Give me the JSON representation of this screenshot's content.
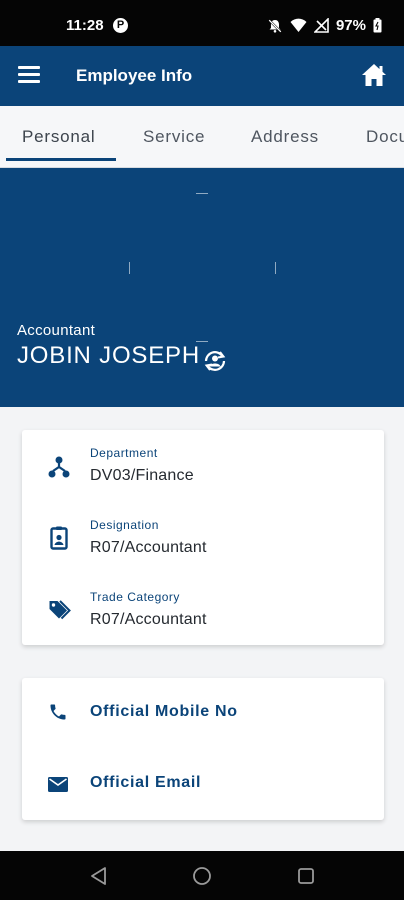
{
  "status_bar": {
    "time": "11:28",
    "notification_icon_letter": "P",
    "battery_percent": "97%",
    "icons": [
      "p-notification-icon",
      "silent-bell-icon",
      "wifi-icon",
      "signal-off-icon",
      "battery-icon"
    ]
  },
  "app_bar": {
    "title": "Employee Info",
    "menu_icon": "hamburger-menu-icon",
    "home_icon": "home-icon"
  },
  "tabs": [
    {
      "label": "Personal",
      "active": true
    },
    {
      "label": "Service",
      "active": false
    },
    {
      "label": "Address",
      "active": false
    },
    {
      "label": "Docu",
      "active": false
    }
  ],
  "profile": {
    "designation": "Accountant",
    "name": "JOBIN JOSEPH",
    "action_icon": "change-user-icon"
  },
  "details": {
    "department": {
      "label": "Department",
      "value": "DV03/Finance",
      "icon": "hierarchy-icon"
    },
    "designation": {
      "label": "Designation",
      "value": "R07/Accountant",
      "icon": "id-badge-icon"
    },
    "trade_category": {
      "label": "Trade Category",
      "value": "R07/Accountant",
      "icon": "tags-icon"
    }
  },
  "contacts": {
    "mobile": {
      "label": "Official Mobile No",
      "icon": "phone-icon"
    },
    "email": {
      "label": "Official Email",
      "icon": "envelope-icon"
    }
  },
  "nav_bar": {
    "icons": [
      "back-icon",
      "home-circle-icon",
      "recents-icon"
    ]
  },
  "colors": {
    "primary": "#0b4479",
    "background": "#f3f4f6",
    "card": "#ffffff",
    "text": "#252a30"
  }
}
